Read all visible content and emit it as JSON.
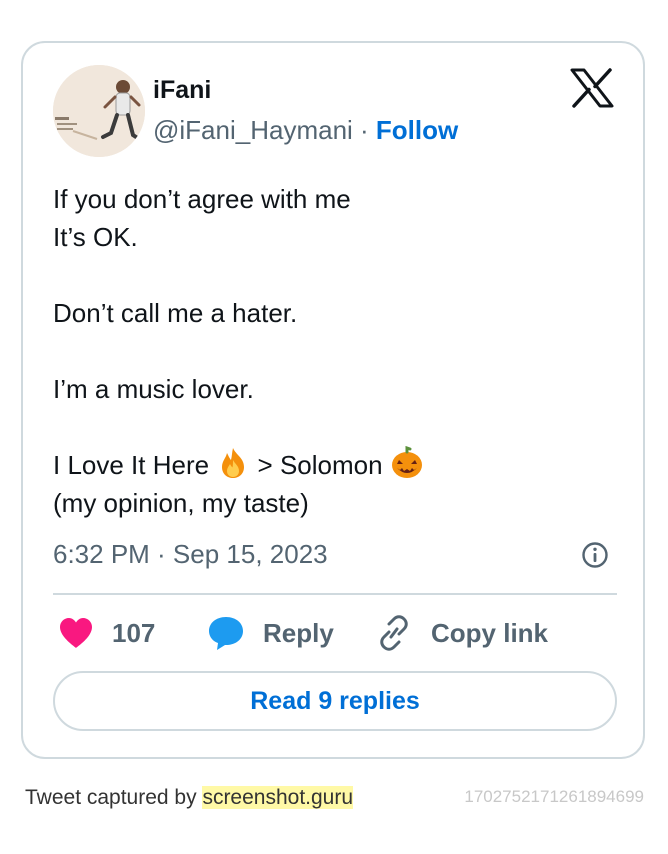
{
  "author": {
    "name": "iFani",
    "handle": "@iFani_Haymani",
    "separator": " · ",
    "follow_label": "Follow"
  },
  "tweet": {
    "lines": [
      "If you don’t agree with me",
      "It’s OK.",
      "",
      "Don’t call me a hater.",
      "",
      "I’m a music lover.",
      ""
    ],
    "line_emoji_a": "I Love It Here",
    "line_emoji_b": " > Solomon",
    "line_last": "(my opinion, my taste)",
    "timestamp": "6:32 PM · Sep 15, 2023"
  },
  "actions": {
    "like_count": "107",
    "reply_label": "Reply",
    "copy_label": "Copy link",
    "read_replies_label": "Read 9 replies"
  },
  "footer": {
    "captured_by": "Tweet captured by ",
    "site": "screenshot.guru",
    "tweet_id": "1702752171261894699"
  },
  "icons": {
    "brand": "x-logo-icon",
    "info": "info-icon",
    "like": "heart-icon",
    "reply": "speech-bubble-icon",
    "copy": "link-icon",
    "emoji_1": "fire-emoji-icon",
    "emoji_2": "jack-o-lantern-emoji-icon"
  },
  "colors": {
    "link_blue": "#006fd6",
    "heart_pink": "#f91880",
    "reply_blue": "#1d9bf0",
    "secondary_text": "#536471",
    "border": "#cfd9de",
    "highlight": "#fff9a6"
  }
}
